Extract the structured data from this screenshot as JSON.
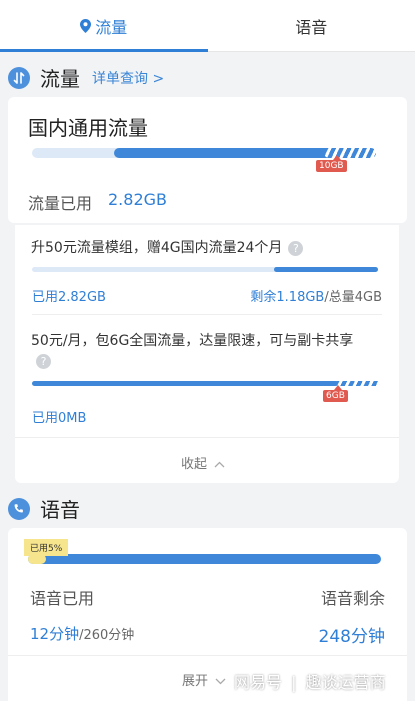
{
  "tabs": [
    {
      "label": "流量",
      "active": true
    },
    {
      "label": "语音",
      "active": false
    }
  ],
  "data_section": {
    "title": "流量",
    "link": "详单查询 >",
    "card": {
      "title": "国内通用流量",
      "used_label": "流量已用",
      "used_value": "2.82GB",
      "total_tag": "10GB",
      "used_fraction": 0.282
    },
    "packages": [
      {
        "name": "升50元流量模组，赠4G国内流量24个月",
        "help": "?",
        "used_text": "已用2.82GB",
        "remaining_text": "剩余1.18GB",
        "total_text": "/总量4GB",
        "used_fraction": 0.705
      },
      {
        "name": "50元/月，包6G全国流量，达量限速，可与副卡共享",
        "help": "?",
        "used_text": "已用0MB",
        "total_tag": "6GB",
        "used_fraction": 0
      }
    ],
    "collapse_label": "收起"
  },
  "voice_section": {
    "title": "语音",
    "used_badge": "已用5%",
    "used_label": "语音已用",
    "remaining_label": "语音剩余",
    "used_value": "12分钟",
    "used_total": "/260分钟",
    "remaining_value": "248分钟",
    "used_fraction": 0.05,
    "expand_label": "展开"
  },
  "watermark": {
    "left": "网易号",
    "right": "趣谈运营商"
  },
  "colors": {
    "accent": "#2f7fd6",
    "bar_fill": "#3f88d9",
    "bar_track": "#dde9f7",
    "tag_red": "#e05a50"
  }
}
